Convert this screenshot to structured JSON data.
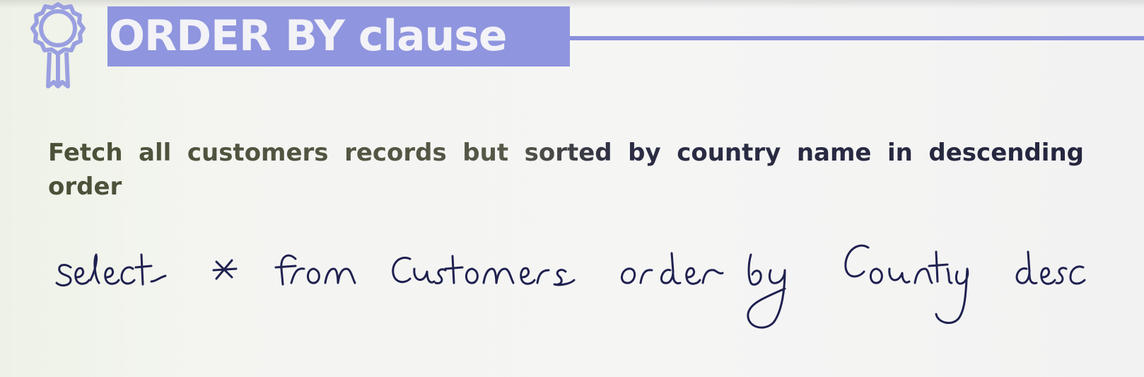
{
  "slide": {
    "title": "ORDER BY clause",
    "question": "Fetch all customers records but sorted by country name in descending order",
    "handwritten_query": "select * from customers order by Country desc"
  },
  "colors": {
    "accent": "#8f95de",
    "title_text": "#f2f2f7",
    "question_text": "#2f3146",
    "ink": "#1f2150"
  }
}
